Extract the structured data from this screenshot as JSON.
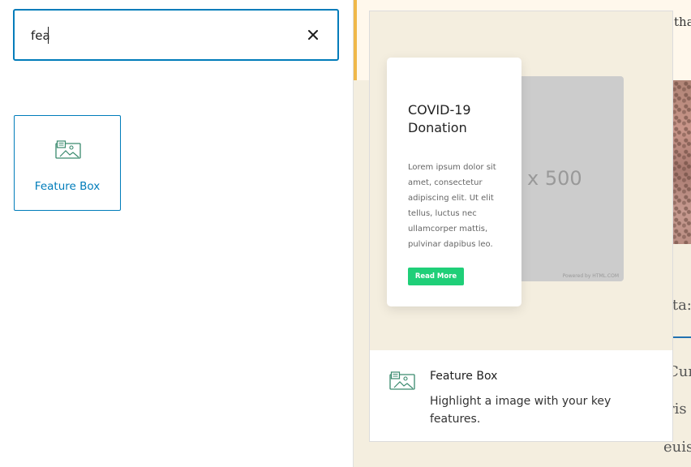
{
  "search": {
    "value": "fea",
    "clear_icon": "close-icon"
  },
  "results": [
    {
      "label": "Feature Box",
      "icon": "feature-box-icon"
    }
  ],
  "editor": {
    "notice_fragment": "tha",
    "text_line_1": "ota:",
    "text_line_2": "Cur",
    "text_line_3": "ris",
    "text_line_4": "euis"
  },
  "preview": {
    "card_title": "COVID-19 Donation",
    "card_body": "Lorem ipsum dolor sit amet, consectetur adipiscing elit. Ut elit tellus, luctus nec ullamcorper mattis, pulvinar dapibus leo.",
    "card_button": "Read More",
    "placeholder_size": "x 500",
    "placeholder_powered": "Powered by HTML.COM",
    "block_title": "Feature Box",
    "block_description": "Highlight a image with your key features."
  },
  "colors": {
    "accent": "#007cba",
    "preview_bg": "#f4eedf",
    "button_green": "#1fcf78",
    "icon_green": "#3a8a6e",
    "notice_border": "#f0b849"
  }
}
